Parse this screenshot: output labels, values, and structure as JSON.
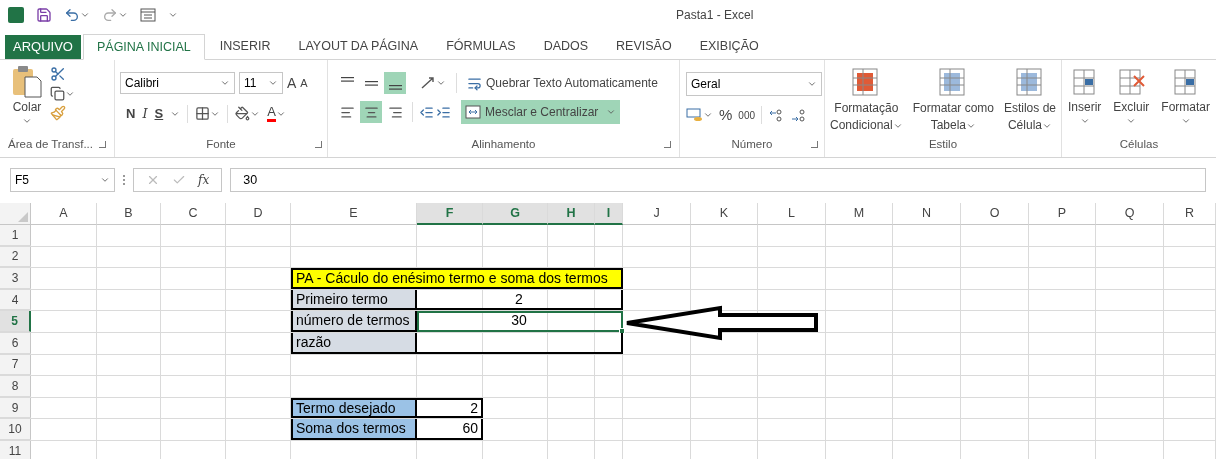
{
  "window": {
    "title": "Pasta1 - Excel"
  },
  "tabs": [
    {
      "label": "ARQUIVO",
      "kind": "file",
      "selected": false
    },
    {
      "label": "PÁGINA INICIAL",
      "kind": "tab",
      "selected": true
    },
    {
      "label": "INSERIR",
      "kind": "tab",
      "selected": false
    },
    {
      "label": "LAYOUT DA PÁGINA",
      "kind": "tab",
      "selected": false
    },
    {
      "label": "FÓRMULAS",
      "kind": "tab",
      "selected": false
    },
    {
      "label": "DADOS",
      "kind": "tab",
      "selected": false
    },
    {
      "label": "REVISÃO",
      "kind": "tab",
      "selected": false
    },
    {
      "label": "EXIBIÇÃO",
      "kind": "tab",
      "selected": false
    }
  ],
  "ribbon": {
    "clipboard": {
      "paste": "Colar",
      "group": "Área de Transf..."
    },
    "font": {
      "name": "Calibri",
      "size": "11",
      "bold": "N",
      "italic": "I",
      "underline": "S",
      "grow": "A",
      "shrink": "A",
      "font_color_label": "A",
      "group": "Fonte"
    },
    "alignment": {
      "vertical": [
        {
          "selected": false
        },
        {
          "selected": false
        },
        {
          "selected": true
        }
      ],
      "horizontal": [
        {
          "selected": false
        },
        {
          "selected": true
        },
        {
          "selected": false
        }
      ],
      "wrap": "Quebrar Texto Automaticamente",
      "merge": {
        "label": "Mesclar e Centralizar",
        "selected": true
      },
      "group": "Alinhamento"
    },
    "number": {
      "format": "Geral",
      "percent": "%",
      "thousands": "000",
      "group": "Número"
    },
    "styles": {
      "buttons": [
        {
          "lines": [
            "Formatação",
            "Condicional"
          ]
        },
        {
          "lines": [
            "Formatar como",
            "Tabela"
          ]
        },
        {
          "lines": [
            "Estilos de",
            "Célula"
          ]
        }
      ],
      "group": "Estilo"
    },
    "cells": {
      "buttons": [
        "Inserir",
        "Excluir",
        "Formatar"
      ],
      "group": "Células"
    }
  },
  "formula_bar": {
    "name_box": "F5",
    "function_symbol": "fx",
    "value": "30"
  },
  "sheet": {
    "columns": [
      {
        "label": "A",
        "selected": false
      },
      {
        "label": "B",
        "selected": false
      },
      {
        "label": "C",
        "selected": false
      },
      {
        "label": "D",
        "selected": false
      },
      {
        "label": "E",
        "selected": false
      },
      {
        "label": "F",
        "selected": true
      },
      {
        "label": "G",
        "selected": true
      },
      {
        "label": "H",
        "selected": true
      },
      {
        "label": "I",
        "selected": true
      },
      {
        "label": "J",
        "selected": false
      },
      {
        "label": "K",
        "selected": false
      },
      {
        "label": "L",
        "selected": false
      },
      {
        "label": "M",
        "selected": false
      },
      {
        "label": "N",
        "selected": false
      },
      {
        "label": "O",
        "selected": false
      },
      {
        "label": "P",
        "selected": false
      },
      {
        "label": "Q",
        "selected": false
      },
      {
        "label": "R",
        "selected": false
      }
    ],
    "rows": [
      {
        "label": "1",
        "selected": false
      },
      {
        "label": "2",
        "selected": false
      },
      {
        "label": "3",
        "selected": false
      },
      {
        "label": "4",
        "selected": false
      },
      {
        "label": "5",
        "selected": true
      },
      {
        "label": "6",
        "selected": false
      },
      {
        "label": "7",
        "selected": false
      },
      {
        "label": "8",
        "selected": false
      },
      {
        "label": "9",
        "selected": false
      },
      {
        "label": "10",
        "selected": false
      },
      {
        "label": "11",
        "selected": false
      }
    ],
    "parameter_table": {
      "title": "PA - Cáculo do enésimo termo e soma dos termos",
      "rows": [
        {
          "label": "Primeiro termo",
          "value": "2",
          "selected": false
        },
        {
          "label": "número de termos",
          "value": "30",
          "selected": true
        },
        {
          "label": "razão",
          "selected": false
        }
      ]
    },
    "result_table": {
      "rows": [
        {
          "label": "Termo desejado",
          "value": "2"
        },
        {
          "label": "Soma dos termos",
          "value": "60"
        }
      ]
    }
  }
}
